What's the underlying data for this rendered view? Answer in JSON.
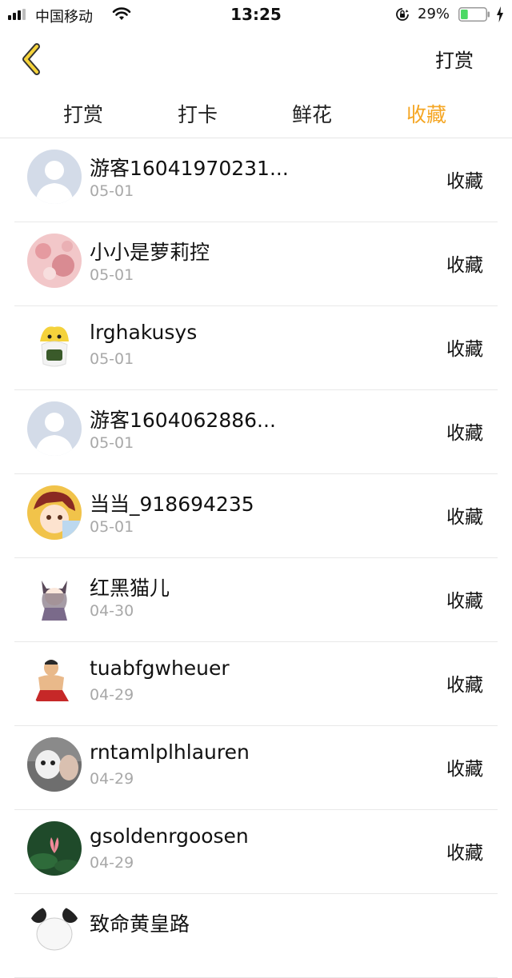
{
  "status_bar": {
    "carrier": "中国移动",
    "time": "13:25",
    "battery_percent": "29%",
    "battery_level": 0.29,
    "icons": [
      "signal-icon",
      "wifi-icon",
      "rotation-lock-icon",
      "battery-icon",
      "charging-bolt-icon"
    ]
  },
  "nav": {
    "back_icon": "chevron-left-icon",
    "action_label": "打赏"
  },
  "tabs": [
    {
      "label": "打赏",
      "active": false
    },
    {
      "label": "打卡",
      "active": false
    },
    {
      "label": "鲜花",
      "active": false
    },
    {
      "label": "收藏",
      "active": true
    }
  ],
  "accent_color": "#f5a623",
  "list": [
    {
      "name": "游客16041970231...",
      "date": "05-01",
      "action": "收藏",
      "avatar": "default-avatar"
    },
    {
      "name": "小小是萝莉控",
      "date": "05-01",
      "action": "收藏",
      "avatar": "pink-pattern-avatar"
    },
    {
      "name": "lrghakusys",
      "date": "05-01",
      "action": "收藏",
      "avatar": "yellow-bird-avatar"
    },
    {
      "name": "游客1604062886...",
      "date": "05-01",
      "action": "收藏",
      "avatar": "default-avatar"
    },
    {
      "name": "当当_918694235",
      "date": "05-01",
      "action": "收藏",
      "avatar": "anime-boy-avatar"
    },
    {
      "name": "红黑猫儿",
      "date": "04-30",
      "action": "收藏",
      "avatar": "cat-girl-avatar"
    },
    {
      "name": "tuabfgwheuer",
      "date": "04-29",
      "action": "收藏",
      "avatar": "cartoon-man-avatar"
    },
    {
      "name": "rntamlplhlauren",
      "date": "04-29",
      "action": "收藏",
      "avatar": "robot-photo-avatar"
    },
    {
      "name": "gsoldenrgoosen",
      "date": "04-29",
      "action": "收藏",
      "avatar": "lotus-avatar"
    },
    {
      "name": "致命黄皇路",
      "date": "",
      "action": "",
      "avatar": "panda-avatar"
    }
  ]
}
